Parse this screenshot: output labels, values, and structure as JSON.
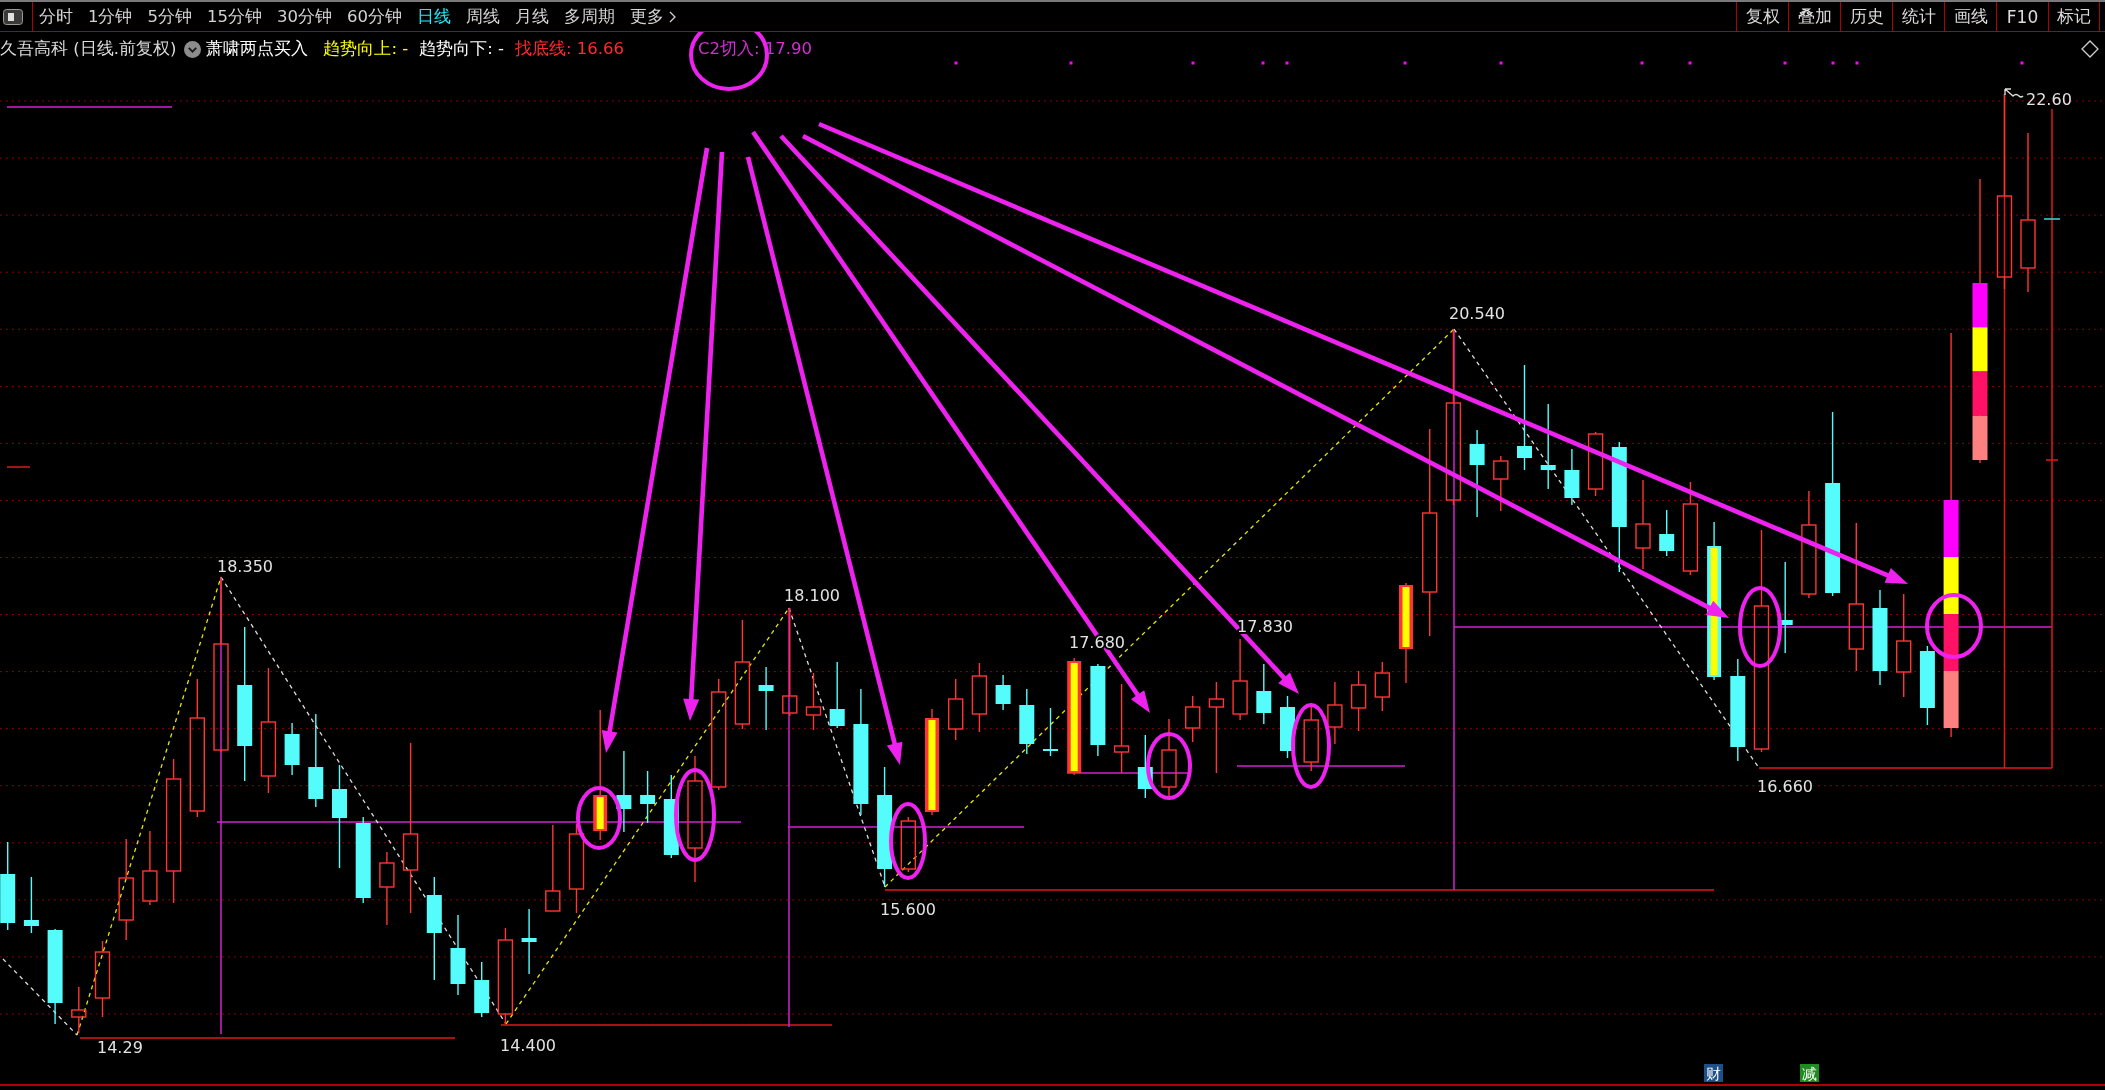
{
  "toolbar": {
    "periods": [
      {
        "label": "分时",
        "selected": false
      },
      {
        "label": "1分钟",
        "selected": false
      },
      {
        "label": "5分钟",
        "selected": false
      },
      {
        "label": "15分钟",
        "selected": false
      },
      {
        "label": "30分钟",
        "selected": false
      },
      {
        "label": "60分钟",
        "selected": false
      },
      {
        "label": "日线",
        "selected": true
      },
      {
        "label": "周线",
        "selected": false
      },
      {
        "label": "月线",
        "selected": false
      },
      {
        "label": "多周期",
        "selected": false
      }
    ],
    "more": {
      "label": "更多"
    },
    "actions": [
      "复权",
      "叠加",
      "历史",
      "统计",
      "画线",
      "F10",
      "标记"
    ]
  },
  "legend": {
    "title": "久吾高科 (日线.前复权)",
    "indicator": "萧啸两点买入",
    "values": [
      {
        "text": "趋势向上: -",
        "color": "#ffff00"
      },
      {
        "text": "趋势向下: -",
        "color": "#ffffff"
      },
      {
        "text": "找底线: 16.66",
        "color": "#ff2a2a"
      },
      {
        "text": "C2切入: 17.90",
        "color": "#d030d0"
      }
    ]
  },
  "chart": {
    "price_labels": [
      "14.29",
      "18.350",
      "14.400",
      "18.100",
      "15.600",
      "17.680",
      "17.830",
      "20.540",
      "16.660"
    ],
    "high_label": "22.60"
  },
  "event_markers": [
    {
      "text": "财",
      "color": "#1d4f88"
    },
    {
      "text": "减",
      "color": "#1e8c1e"
    }
  ]
}
